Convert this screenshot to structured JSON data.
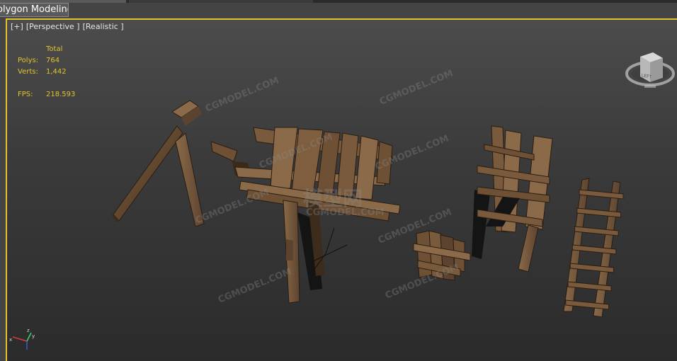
{
  "ribbon": {
    "active_tab": "olygon Modeling"
  },
  "viewport": {
    "label": {
      "plus": "[+]",
      "view": "[Perspective ]",
      "shading": "[Realistic ]"
    },
    "stats": {
      "header": "Total",
      "polys_label": "Polys:",
      "polys_value": "764",
      "verts_label": "Verts:",
      "verts_value": "1,442",
      "fps_label": "FPS:",
      "fps_value": "218.593"
    },
    "viewcube": {
      "face_label": "LEFT"
    },
    "axis": {
      "x": "x",
      "y": "y",
      "z": "z"
    },
    "watermarks": [
      "CGMODEL.COM",
      "模型网"
    ]
  },
  "colors": {
    "accent": "#e3c22c",
    "viewport_top": "#4c4c4c",
    "viewport_bottom": "#2b2b2b",
    "wood": "#6e5035"
  },
  "icons": [
    "viewcube-icon",
    "axis-tripod-icon"
  ]
}
